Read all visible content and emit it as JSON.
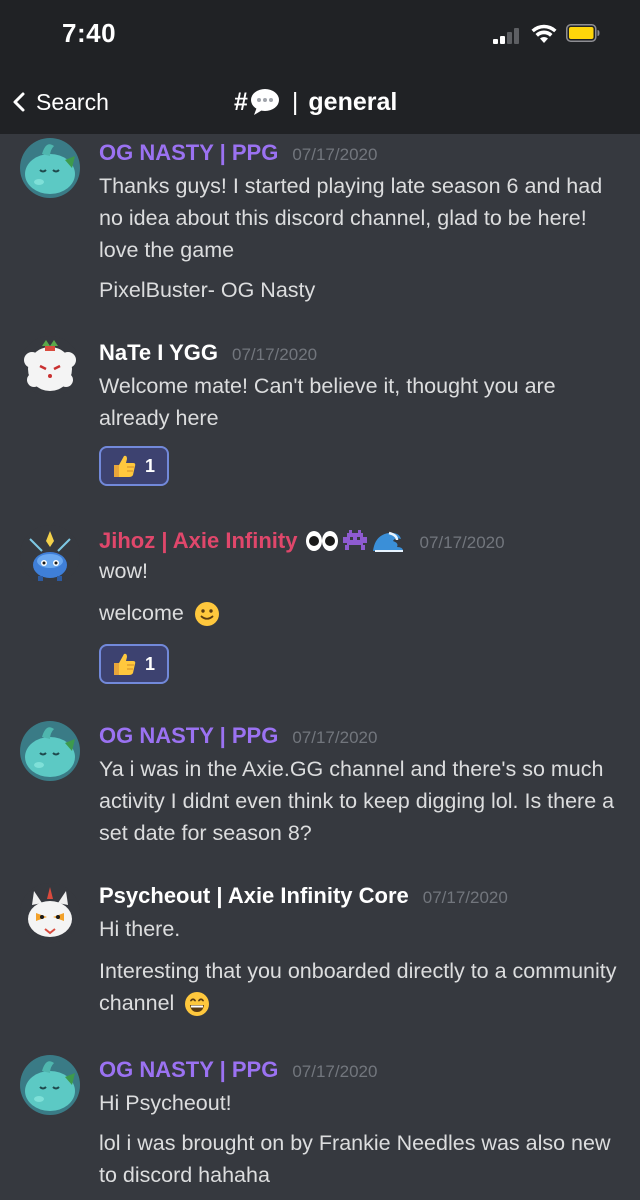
{
  "status": {
    "time": "7:40"
  },
  "nav": {
    "back_label": "Search",
    "channel_prefix": "#",
    "channel_sep": "|",
    "channel_name": "general"
  },
  "colors": {
    "background": "#36393f",
    "bar": "#202225",
    "og_nasty": "#9b72f2",
    "jihoz": "#e0476b",
    "timestamp": "#72767d",
    "reaction_border": "#7289da"
  },
  "messages": [
    {
      "author": "OG NASTY | PPG",
      "timestamp": "07/17/2020",
      "lines": [
        "Thanks guys! I started playing late season 6 and had no idea about this discord channel, glad to be here! love the game",
        "PixelBuster- OG Nasty"
      ]
    },
    {
      "author": "NaTe I YGG",
      "timestamp": "07/17/2020",
      "lines": [
        "Welcome mate! Can't believe it, thought you are already here"
      ],
      "reaction": {
        "emoji": "thumbs-up-icon",
        "count": "1"
      }
    },
    {
      "author": "Jihoz  | Axie Infinity",
      "timestamp": "07/17/2020",
      "author_emojis": [
        "eyes-icon",
        "space-invader-icon",
        "wave-icon"
      ],
      "lines": [
        "wow!",
        "welcome"
      ],
      "reaction": {
        "emoji": "thumbs-up-icon",
        "count": "1"
      }
    },
    {
      "author": "OG NASTY | PPG",
      "timestamp": "07/17/2020",
      "lines": [
        "Ya i was in the Axie.GG channel and there's so much activity I didnt even think to keep digging lol. Is there a set date for season 8?"
      ]
    },
    {
      "author": "Psycheout | Axie Infinity Core",
      "timestamp": "07/17/2020",
      "lines": [
        "Hi there.",
        "Interesting that you onboarded directly to a community channel"
      ]
    },
    {
      "author": "OG NASTY | PPG",
      "timestamp": "07/17/2020",
      "lines": [
        "Hi Psycheout!",
        "lol i was brought on by Frankie Needles was also new to discord hahaha"
      ]
    }
  ]
}
